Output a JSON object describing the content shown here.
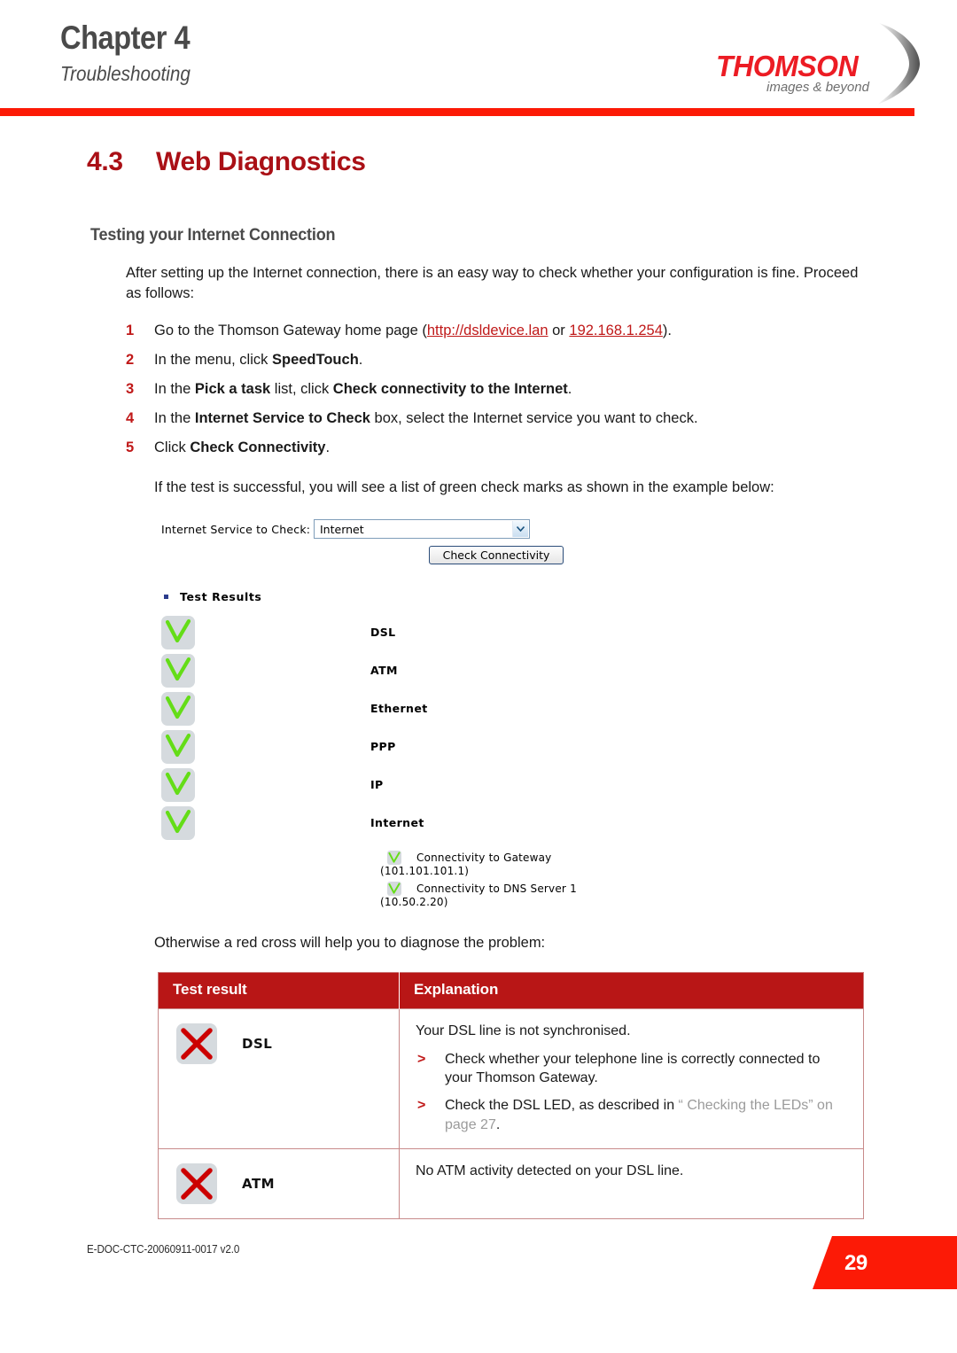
{
  "header": {
    "chapter": "Chapter 4",
    "chapter_subtitle": "Troubleshooting",
    "logo_word": "THOMSON",
    "logo_tagline": "images & beyond",
    "rule_color": "#fc1a06"
  },
  "section": {
    "number": "4.3",
    "title": "Web Diagnostics",
    "color": "#aa1016"
  },
  "body": {
    "subheading": "Testing your Internet Connection",
    "intro": "After setting up the Internet connection, there is an easy way to check whether your configuration is fine. Proceed as follows:",
    "steps": [
      {
        "num": "1",
        "parts": [
          {
            "text": "Go to the Thomson Gateway home page (",
            "style": "normal"
          },
          {
            "text": "http://dsldevice.lan",
            "style": "link"
          },
          {
            "text": " or ",
            "style": "normal"
          },
          {
            "text": "192.168.1.254",
            "style": "link"
          },
          {
            "text": ").",
            "style": "normal"
          }
        ]
      },
      {
        "num": "2",
        "parts": [
          {
            "text": "In the menu, click ",
            "style": "normal"
          },
          {
            "text": "SpeedTouch",
            "style": "bold"
          },
          {
            "text": ".",
            "style": "normal"
          }
        ]
      },
      {
        "num": "3",
        "parts": [
          {
            "text": "In the ",
            "style": "normal"
          },
          {
            "text": "Pick a task",
            "style": "bold"
          },
          {
            "text": " list, click ",
            "style": "normal"
          },
          {
            "text": "Check connectivity to the Internet",
            "style": "bold"
          },
          {
            "text": ".",
            "style": "normal"
          }
        ]
      },
      {
        "num": "4",
        "parts": [
          {
            "text": "In the ",
            "style": "normal"
          },
          {
            "text": "Internet Service to Check",
            "style": "bold"
          },
          {
            "text": " box, select the Internet service you want to check.",
            "style": "normal"
          }
        ]
      },
      {
        "num": "5",
        "parts": [
          {
            "text": "Click ",
            "style": "normal"
          },
          {
            "text": "Check Connectivity",
            "style": "bold"
          },
          {
            "text": ".",
            "style": "normal"
          }
        ]
      }
    ],
    "success_note": "If the test is successful, you will see a list of green check marks as shown in the example below:",
    "otherwise_note": "Otherwise a red cross will help you to diagnose the problem:"
  },
  "webshot": {
    "service_label": "Internet Service to Check:",
    "service_value": "Internet",
    "service_options": [
      "Internet"
    ],
    "check_button": "Check Connectivity",
    "results_title": "Test Results",
    "checks": [
      {
        "label": "DSL",
        "status": "pass"
      },
      {
        "label": "ATM",
        "status": "pass"
      },
      {
        "label": "Ethernet",
        "status": "pass"
      },
      {
        "label": "PPP",
        "status": "pass"
      },
      {
        "label": "IP",
        "status": "pass"
      },
      {
        "label": "Internet",
        "status": "pass"
      }
    ],
    "sub_checks": [
      {
        "name": "Connectivity to Gateway",
        "address": "(101.101.101.1)",
        "status": "pass"
      },
      {
        "name": "Connectivity to DNS Server 1",
        "address": "(10.50.2.20)",
        "status": "pass"
      }
    ],
    "check_color": "#64dd17",
    "icon_bg": "#d5dade"
  },
  "table": {
    "headers": {
      "result": "Test result",
      "explanation": "Explanation"
    },
    "header_bg": "#b81616",
    "rows": [
      {
        "icon_label": "DSL",
        "icon_status": "fail",
        "explanation_first": "Your DSL line is not synchronised.",
        "bullets": [
          {
            "parts": [
              {
                "text": "Check whether your telephone line is correctly connected to your Thomson Gateway.",
                "style": "normal"
              }
            ]
          },
          {
            "parts": [
              {
                "text": "Check the DSL LED, as described in ",
                "style": "normal"
              },
              {
                "text": "“ Checking the LEDs” on page 27",
                "style": "xref"
              },
              {
                "text": ".",
                "style": "normal"
              }
            ]
          }
        ]
      },
      {
        "icon_label": "ATM",
        "icon_status": "fail",
        "explanation_first": "No ATM activity detected on your DSL line.",
        "bullets": []
      }
    ],
    "cross_color": "#cc0000"
  },
  "footer": {
    "doc_code": "E-DOC-CTC-20060911-0017 v2.0",
    "page_number": "29",
    "tab_color": "#fc1a06"
  }
}
